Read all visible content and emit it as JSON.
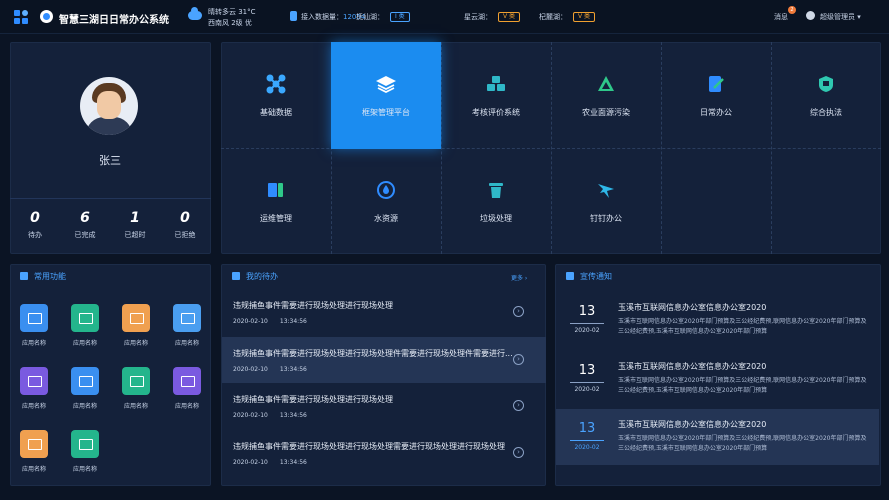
{
  "header": {
    "title": "智慧三湖日日常办公系统",
    "weather_line1": "晴转多云    31°C",
    "weather_line2": "西南风  2级   优",
    "access_label": "接入数据量：",
    "access_value": "12054",
    "lakes": [
      {
        "name": "抚仙湖：",
        "grade": "Ⅰ 类",
        "color": "blue"
      },
      {
        "name": "星云湖：",
        "grade": "Ⅴ 类",
        "color": "orange"
      },
      {
        "name": "杞麓湖：",
        "grade": "Ⅴ 类",
        "color": "orange"
      }
    ],
    "messages_label": "消息",
    "messages_count": "2",
    "user_label": "超级管理员"
  },
  "profile": {
    "name": "张三",
    "stats": [
      {
        "value": "0",
        "label": "待办"
      },
      {
        "value": "6",
        "label": "已完成"
      },
      {
        "value": "1",
        "label": "已超时"
      },
      {
        "value": "0",
        "label": "已拒绝"
      }
    ]
  },
  "modules": [
    {
      "label": "基础数据",
      "icon": "network-icon",
      "color": "#3aa8ff"
    },
    {
      "label": "框架管理平台",
      "icon": "layers-icon",
      "color": "#ffffff",
      "active": true
    },
    {
      "label": "考核评价系统",
      "icon": "cubes-icon",
      "color": "#2fb8c8"
    },
    {
      "label": "农业面源污染",
      "icon": "recycle-icon",
      "color": "#2fc88a"
    },
    {
      "label": "日常办公",
      "icon": "edit-icon",
      "color": "#2f8cff"
    },
    {
      "label": "综合执法",
      "icon": "shield-icon",
      "color": "#2fc8b0"
    },
    {
      "label": "运维管理",
      "icon": "tools-icon",
      "color": "#2f8cff"
    },
    {
      "label": "水资源",
      "icon": "water-drop-icon",
      "color": "#2f8cff"
    },
    {
      "label": "垃圾处理",
      "icon": "trash-icon",
      "color": "#2fb8c8"
    },
    {
      "label": "钉钉办公",
      "icon": "dingtalk-icon",
      "color": "#2fb8e8"
    }
  ],
  "common_functions": {
    "title": "常用功能",
    "apps": [
      {
        "label": "应用名称",
        "color": "#3a8ff0"
      },
      {
        "label": "应用名称",
        "color": "#24b58c"
      },
      {
        "label": "应用名称",
        "color": "#f0a050"
      },
      {
        "label": "应用名称",
        "color": "#4a9ef0"
      },
      {
        "label": "应用名称",
        "color": "#7a5ae0"
      },
      {
        "label": "应用名称",
        "color": "#3a8ff0"
      },
      {
        "label": "应用名称",
        "color": "#24b58c"
      },
      {
        "label": "应用名称",
        "color": "#7a5ae0"
      },
      {
        "label": "应用名称",
        "color": "#f0a050"
      },
      {
        "label": "应用名称",
        "color": "#24b58c"
      }
    ]
  },
  "todos": {
    "title": "我的待办",
    "more": "更多 ›",
    "items": [
      {
        "title": "违规捕鱼事件需要进行现场处理进行现场处理",
        "date": "2020-02-10",
        "time": "13:34:56"
      },
      {
        "title": "违规捕鱼事件需要进行现场处理进行现场处理件需要进行现场处理件需要进行...",
        "date": "2020-02-10",
        "time": "13:34:56",
        "active": true
      },
      {
        "title": "违规捕鱼事件需要进行现场处理进行现场处理",
        "date": "2020-02-10",
        "time": "13:34:56"
      },
      {
        "title": "违规捕鱼事件需要进行现场处理进行现场处理需要进行现场处理进行现场处理",
        "date": "2020-02-10",
        "time": "13:34:56"
      }
    ]
  },
  "notices": {
    "title": "宣传通知",
    "items": [
      {
        "day": "13",
        "month": "2020-02",
        "title": "玉溪市互联网信息办公室信息办公室2020",
        "body": "玉溪市互联网信息办公室2020年部门预算及三公经纪费预,联网信息办公室2020年部门预算及三公经纪费预,玉溪市互联网信息办公室2020年部门预算"
      },
      {
        "day": "13",
        "month": "2020-02",
        "title": "玉溪市互联网信息办公室信息办公室2020",
        "body": "玉溪市互联网信息办公室2020年部门预算及三公经纪费预,联网信息办公室2020年部门预算及三公经纪费预,玉溪市互联网信息办公室2020年部门预算"
      },
      {
        "day": "13",
        "month": "2020-02",
        "title": "玉溪市互联网信息办公室信息办公室2020",
        "body": "玉溪市互联网信息办公室2020年部门预算及三公经纪费预,联网信息办公室2020年部门预算及三公经纪费预,玉溪市互联网信息办公室2020年部门预算",
        "active": true
      }
    ]
  }
}
